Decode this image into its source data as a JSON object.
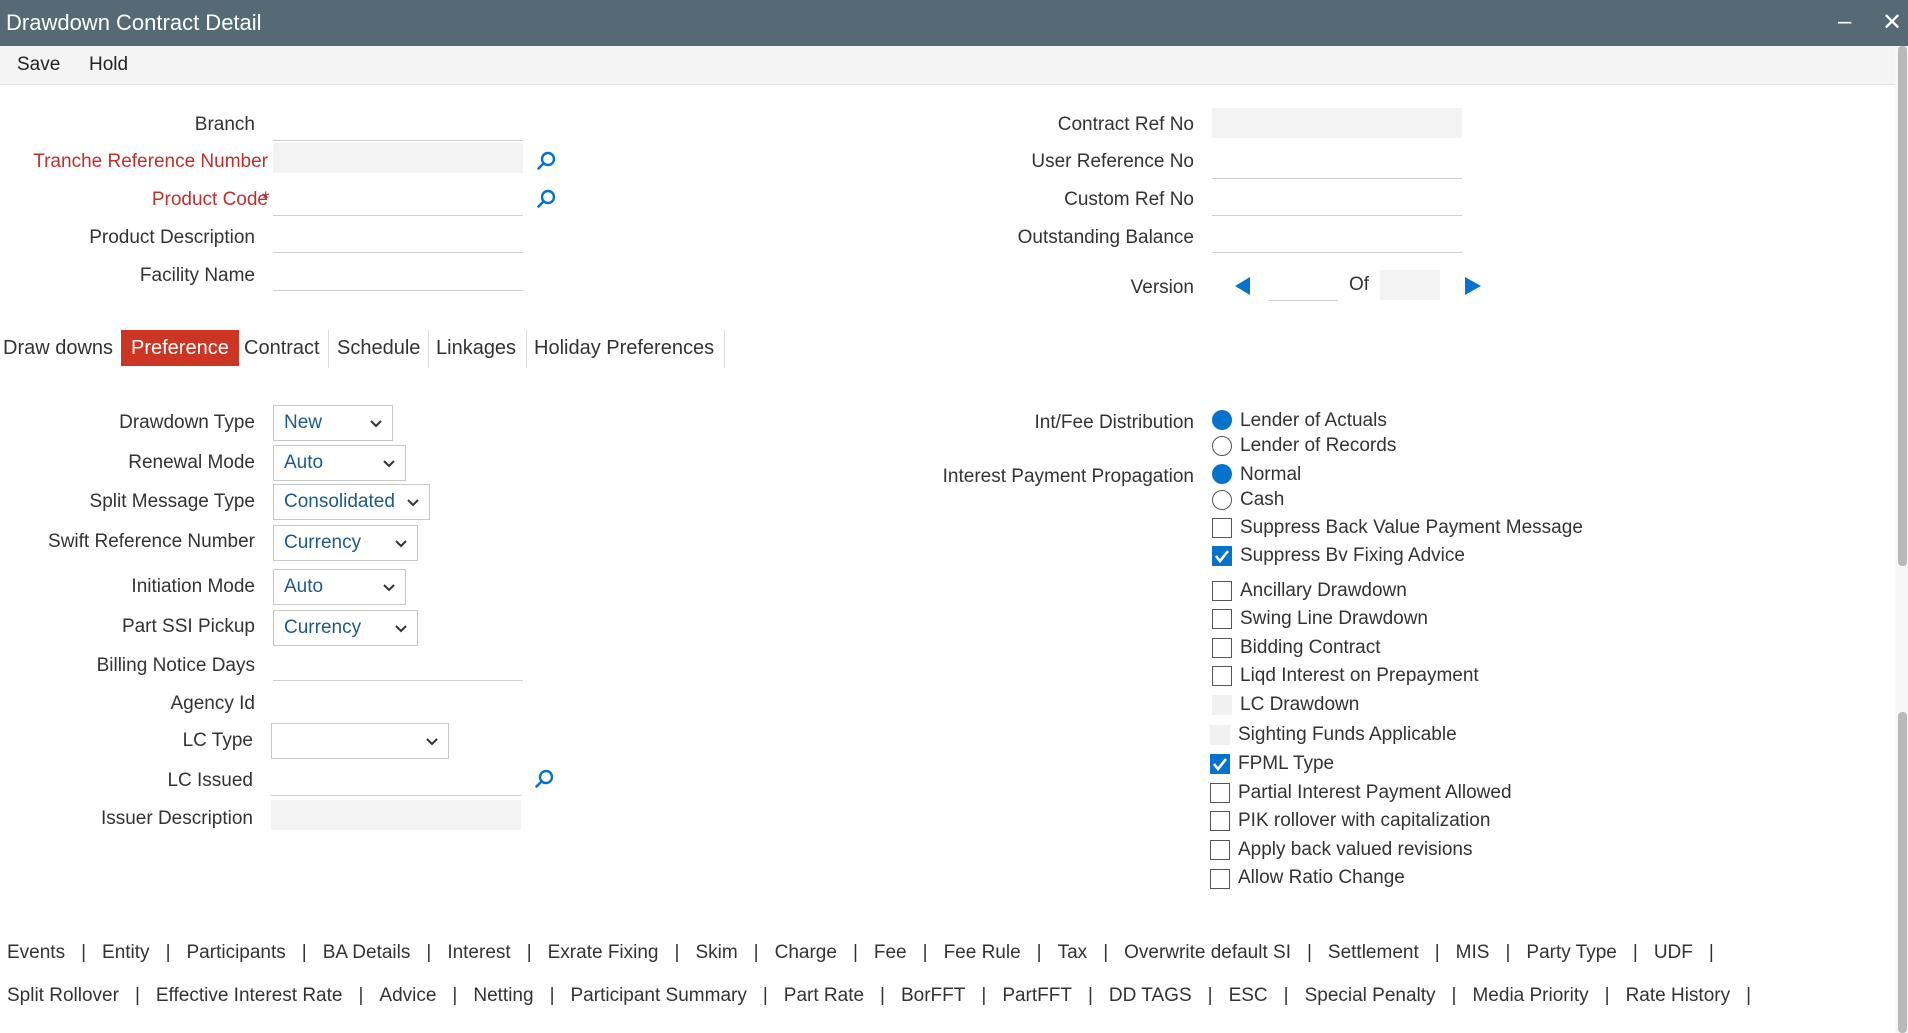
{
  "window": {
    "title": "Drawdown Contract Detail",
    "minimize_symbol": "–",
    "close_symbol": "✕"
  },
  "toolbar": {
    "save": "Save",
    "hold": "Hold"
  },
  "header_left": {
    "branch": "Branch",
    "tranche_ref": "Tranche Reference Number",
    "product_code": "Product Code",
    "product_desc": "Product Description",
    "facility_name": "Facility Name",
    "required_mark": "*"
  },
  "header_right": {
    "contract_ref": "Contract Ref No",
    "user_ref": "User Reference No",
    "custom_ref": "Custom Ref No",
    "outstanding": "Outstanding Balance",
    "version": "Version",
    "of": "Of"
  },
  "tabs": [
    "Draw downs",
    "Preference",
    "Contract",
    "Schedule",
    "Linkages",
    "Holiday Preferences"
  ],
  "active_tab": "Preference",
  "pref_left": {
    "drawdown_type": {
      "label": "Drawdown Type",
      "value": "New"
    },
    "renewal_mode": {
      "label": "Renewal Mode",
      "value": "Auto"
    },
    "split_msg": {
      "label": "Split Message Type",
      "value": "Consolidated"
    },
    "swift_ref": {
      "label": "Swift Reference Number",
      "value": "Currency"
    },
    "initiation": {
      "label": "Initiation Mode",
      "value": "Auto"
    },
    "part_ssi": {
      "label": "Part SSI Pickup",
      "value": "Currency"
    },
    "billing_days": "Billing Notice Days",
    "agency_id": "Agency Id",
    "lc_type": {
      "label": "LC Type",
      "value": ""
    },
    "lc_issued": "LC Issued",
    "issuer_desc": "Issuer Description"
  },
  "pref_right": {
    "int_fee_dist": {
      "label": "Int/Fee Distribution",
      "opt1": "Lender of Actuals",
      "opt2": "Lender of Records",
      "selected": "Lender of Actuals"
    },
    "int_pay_prop": {
      "label": "Interest Payment Propagation",
      "opt1": "Normal",
      "opt2": "Cash",
      "selected": "Normal"
    },
    "checks": [
      {
        "label": "Suppress Back Value Payment Message",
        "checked": false,
        "disabled": false
      },
      {
        "label": "Suppress Bv Fixing Advice",
        "checked": true,
        "disabled": false
      },
      {
        "label": "Ancillary Drawdown",
        "checked": false,
        "disabled": false
      },
      {
        "label": "Swing Line Drawdown",
        "checked": false,
        "disabled": false
      },
      {
        "label": "Bidding Contract",
        "checked": false,
        "disabled": false
      },
      {
        "label": "Liqd Interest on Prepayment",
        "checked": false,
        "disabled": false
      },
      {
        "label": "LC Drawdown",
        "checked": false,
        "disabled": true
      },
      {
        "label": "Sighting Funds Applicable",
        "checked": false,
        "disabled": true
      },
      {
        "label": "FPML Type",
        "checked": true,
        "disabled": false
      },
      {
        "label": "Partial Interest Payment Allowed",
        "checked": false,
        "disabled": false
      },
      {
        "label": "PIK rollover with capitalization",
        "checked": false,
        "disabled": false
      },
      {
        "label": "Apply back valued revisions",
        "checked": false,
        "disabled": false
      },
      {
        "label": "Allow Ratio Change",
        "checked": false,
        "disabled": false
      }
    ]
  },
  "bottom_links_row1": [
    "Events",
    "Entity",
    "Participants",
    "BA Details",
    "Interest",
    "Exrate Fixing",
    "Skim",
    "Charge",
    "Fee",
    "Fee Rule",
    "Tax",
    "Overwrite default SI",
    "Settlement",
    "MIS",
    "Party Type",
    "UDF"
  ],
  "bottom_links_row2": [
    "Split Rollover",
    "Effective Interest Rate",
    "Advice",
    "Netting",
    "Participant Summary",
    "Part Rate",
    "BorFFT",
    "PartFFT",
    "DD TAGS",
    "ESC",
    "Special Penalty",
    "Media Priority",
    "Rate History"
  ],
  "separator": "|",
  "colors": {
    "titlebar": "#556a74",
    "active_tab": "#cc3524",
    "accent_blue": "#0572ce",
    "required_red": "#c0302b"
  }
}
